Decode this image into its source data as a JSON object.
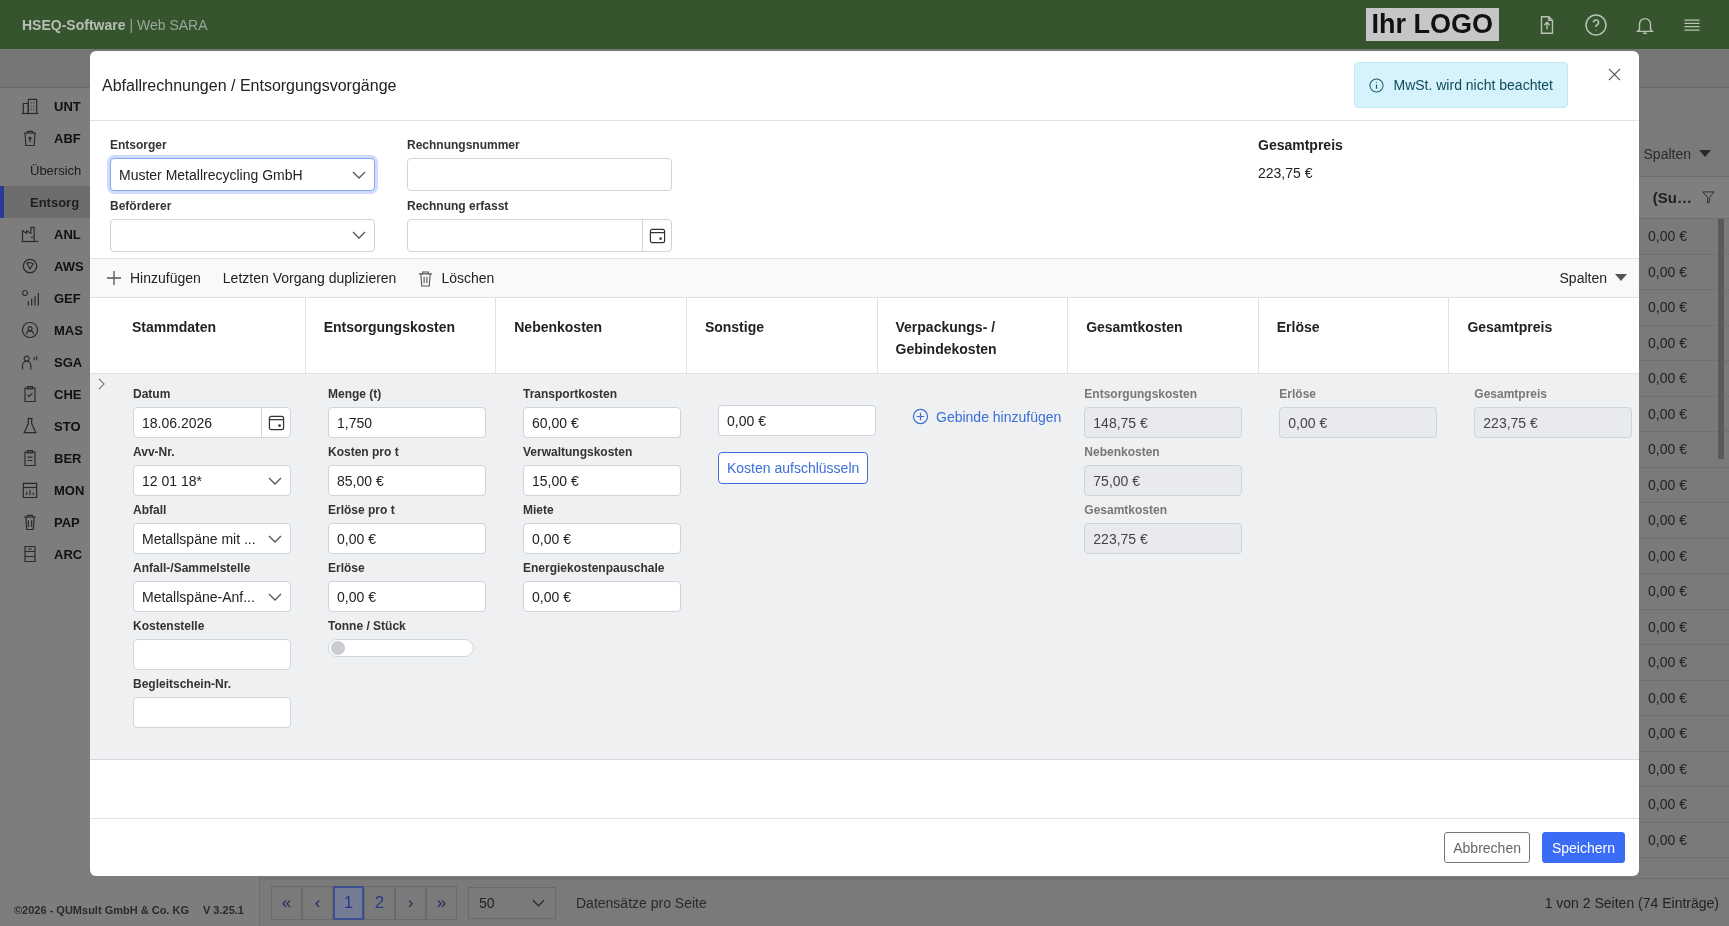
{
  "app_bar": {
    "brand": "HSEQ-Software",
    "product": "| Web SARA",
    "logo": "Ihr LOGO"
  },
  "sidebar": {
    "items": [
      {
        "label": "UNT",
        "kind": "section",
        "selected": false
      },
      {
        "label": "ABF",
        "kind": "section",
        "selected": false
      },
      {
        "label": "Übersich",
        "kind": "sub",
        "selected": false
      },
      {
        "label": "Entsorg",
        "kind": "sub",
        "selected": true
      },
      {
        "label": "ANL",
        "kind": "section",
        "selected": false
      },
      {
        "label": "AWS",
        "kind": "section",
        "selected": false
      },
      {
        "label": "GEF",
        "kind": "section",
        "selected": false
      },
      {
        "label": "MAS",
        "kind": "section",
        "selected": false
      },
      {
        "label": "SGA",
        "kind": "section",
        "selected": false
      },
      {
        "label": "CHE",
        "kind": "section",
        "selected": false
      },
      {
        "label": "STO",
        "kind": "section",
        "selected": false
      },
      {
        "label": "BER",
        "kind": "section",
        "selected": false
      },
      {
        "label": "MON",
        "kind": "section",
        "selected": false
      },
      {
        "label": "PAP",
        "kind": "section",
        "selected": false
      },
      {
        "label": "ARC",
        "kind": "section",
        "selected": false
      }
    ],
    "footer": {
      "copyright": "©2026 - QUMsult GmbH & Co. KG",
      "version": "V 3.25.1"
    }
  },
  "background_table": {
    "columns_button": "Spalten",
    "column_header": "(Su…",
    "rows": [
      "0,00 €",
      "0,00 €",
      "0,00 €",
      "0,00 €",
      "0,00 €",
      "0,00 €",
      "0,00 €",
      "0,00 €",
      "0,00 €",
      "0,00 €",
      "0,00 €",
      "0,00 €",
      "0,00 €",
      "0,00 €",
      "0,00 €",
      "0,00 €",
      "0,00 €",
      "0,00 €"
    ]
  },
  "pagination": {
    "first": "«",
    "prev": "‹",
    "pages": [
      {
        "label": "1",
        "selected": true
      },
      {
        "label": "2",
        "selected": false
      }
    ],
    "next": "›",
    "last": "»",
    "page_size": "50",
    "page_size_label": "Datensätze pro Seite",
    "summary": "1 von 2 Seiten (74 Einträge)"
  },
  "modal": {
    "title": "Abfallrechnungen / Entsorgungsvorgänge",
    "notice": "MwSt. wird nicht beachtet",
    "header_fields": [
      {
        "kind": "select",
        "label": "Entsorger",
        "value": "Muster Metallrecycling GmbH",
        "focused": true
      },
      {
        "kind": "select",
        "label": "Beförderer",
        "focused": false
      },
      {
        "kind": "input",
        "label": "Rechnungsnummer",
        "focused": false
      },
      {
        "kind": "date",
        "label": "Rechnung erfasst",
        "focused": false
      }
    ],
    "total": {
      "label": "Gesamtpreis",
      "value": "223,75 €"
    },
    "toolbar": {
      "actions": [
        {
          "kind": "add",
          "label": "Hinzufügen"
        },
        {
          "kind": "duplicate",
          "label": "Letzten Vorgang duplizieren"
        },
        {
          "kind": "delete",
          "label": "Löschen"
        }
      ],
      "columns_button": "Spalten"
    },
    "columns": [
      "Stammdaten",
      "Entsorgungskosten",
      "Nebenkosten",
      "Sonstige",
      "Verpackungs- / Gebindekosten",
      "Gesamtkosten",
      "Erlöse",
      "Gesamtpreis"
    ],
    "row": {
      "cells": [
        [
          {
            "kind": "date",
            "label": "Datum",
            "value": "18.06.2026"
          },
          {
            "kind": "select",
            "label": "Avv-Nr.",
            "value": "12 01 18*"
          },
          {
            "kind": "select",
            "label": "Abfall",
            "value": "Metallspäne mit ..."
          },
          {
            "kind": "select",
            "label": "Anfall-/Sammelstelle",
            "value": "Metallspäne-Anf..."
          },
          {
            "kind": "input",
            "label": "Kostenstelle"
          },
          {
            "kind": "input",
            "label": "Begleitschein-Nr."
          }
        ],
        [
          {
            "kind": "input",
            "label": "Menge (t)",
            "value": "1,750"
          },
          {
            "kind": "input",
            "label": "Kosten pro t",
            "value": "85,00 €"
          },
          {
            "kind": "input",
            "label": "Erlöse pro t",
            "value": "0,00 €"
          },
          {
            "kind": "input",
            "label": "Erlöse",
            "value": "0,00 €"
          },
          {
            "kind": "toggle",
            "label": "Tonne / Stück",
            "on": false
          }
        ],
        [
          {
            "kind": "input",
            "label": "Transportkosten",
            "value": "60,00 €"
          },
          {
            "kind": "input",
            "label": "Verwaltungskosten",
            "value": "15,00 €"
          },
          {
            "kind": "input",
            "label": "Miete",
            "value": "0,00 €"
          },
          {
            "kind": "input",
            "label": "Energiekostenpauschale",
            "value": "0,00 €"
          }
        ],
        [
          {
            "kind": "input",
            "value": "0,00 €"
          },
          {
            "kind": "button",
            "label": "Kosten aufschlüsseln"
          }
        ],
        [
          {
            "kind": "link",
            "label": "Gebinde hinzufügen"
          }
        ],
        [
          {
            "kind": "readonly",
            "label": "Entsorgungskosten",
            "value": "148,75 €"
          },
          {
            "kind": "readonly",
            "label": "Nebenkosten",
            "value": "75,00 €"
          },
          {
            "kind": "readonly",
            "label": "Gesamtkosten",
            "value": "223,75 €"
          }
        ],
        [
          {
            "kind": "readonly",
            "label": "Erlöse",
            "value": "0,00 €"
          }
        ],
        [
          {
            "kind": "readonly",
            "label": "Gesamtpreis",
            "value": "223,75 €"
          }
        ]
      ]
    },
    "buttons": [
      {
        "kind": "secondary",
        "label": "Abbrechen"
      },
      {
        "kind": "primary",
        "label": "Speichern"
      }
    ]
  }
}
